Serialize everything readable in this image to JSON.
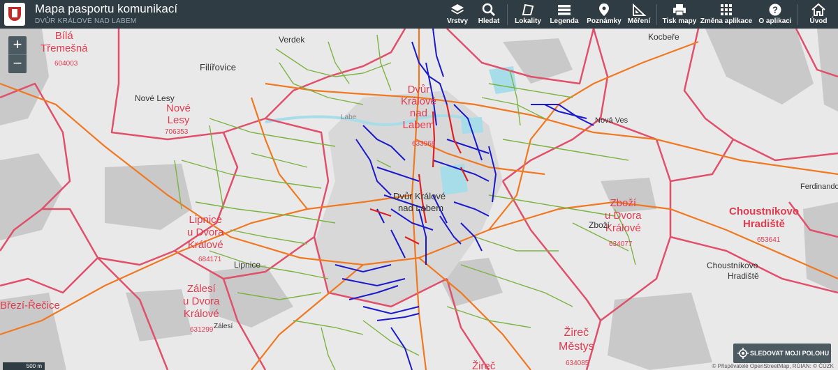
{
  "header": {
    "title": "Mapa pasportu komunikací",
    "subtitle": "DVŮR KRÁLOVÉ NAD LABEM"
  },
  "nav": {
    "vrstvy": "Vrstvy",
    "hledat": "Hledat",
    "lokality": "Lokality",
    "legenda": "Legenda",
    "poznamky": "Poznámky",
    "mereni": "Měření",
    "tisk": "Tisk mapy",
    "zmena": "Změna aplikace",
    "oaplikaci": "O aplikaci",
    "uvod": "Úvod"
  },
  "zoom": {
    "in": "+",
    "out": "−"
  },
  "track_button": "SLEDOVAT MOJI POLOHU",
  "scale_text": "500 m",
  "attribution": "© Přispěvatelé OpenStreetMap, RÚIAN: © ČÚZK",
  "cadastral_areas": [
    {
      "name1": "Bílá",
      "name2": "Třemešná",
      "code": "604003"
    },
    {
      "name1": "Nové",
      "name2": "Lesy",
      "code": "706353"
    },
    {
      "name1": "Dvůr",
      "name2": "Králové",
      "name3": "nad",
      "name4": "Labem",
      "code": "633968"
    },
    {
      "name1": "Lipnice",
      "name2": "u Dvora",
      "name3": "Králové",
      "code": "684171"
    },
    {
      "name1": "Zálesí",
      "name2": "u Dvora",
      "name3": "Králové",
      "code": "631299"
    },
    {
      "name1": "Zboží",
      "name2": "u Dvora",
      "name3": "Králové",
      "code": "634077"
    },
    {
      "name1": "Choustníkovo",
      "name2": "Hradiště",
      "code": "653641"
    },
    {
      "name1": "Žireč",
      "name2": "Městys",
      "code": "634085"
    },
    {
      "name1": "Žireč"
    },
    {
      "name1": "Březí-Řečice"
    }
  ],
  "places": {
    "verdek": "Verdek",
    "filirovice": "Filířovice",
    "nove_lesy": "Nové Lesy",
    "kocbere": "Kocbeře",
    "nova_ves": "Nová Ves",
    "ferdinandov": "Ferdinandov",
    "zbozi": "Zboží",
    "choustnikovo": "Choustníkovo",
    "hradiste": "Hradiště",
    "lipnice": "Lipnice",
    "zalesi": "Zálesí",
    "labe": "Labe",
    "dvur_center": "Dvůr Králové",
    "nad_labem": "nad Labem"
  },
  "colors": {
    "header_bg": "#2f3c44",
    "boundary": "#e0506a",
    "road_main": "#f07820",
    "road_local": "#7cb342",
    "road_city": "#1a1acc",
    "road_red": "#e02020",
    "forest": "#c8c8c8",
    "water": "#a6dde8"
  },
  "icons": [
    "layers-icon",
    "search-icon",
    "locality-icon",
    "legend-icon",
    "note-icon",
    "measure-icon",
    "print-icon",
    "apps-icon",
    "info-icon",
    "home-icon",
    "locate-icon"
  ]
}
